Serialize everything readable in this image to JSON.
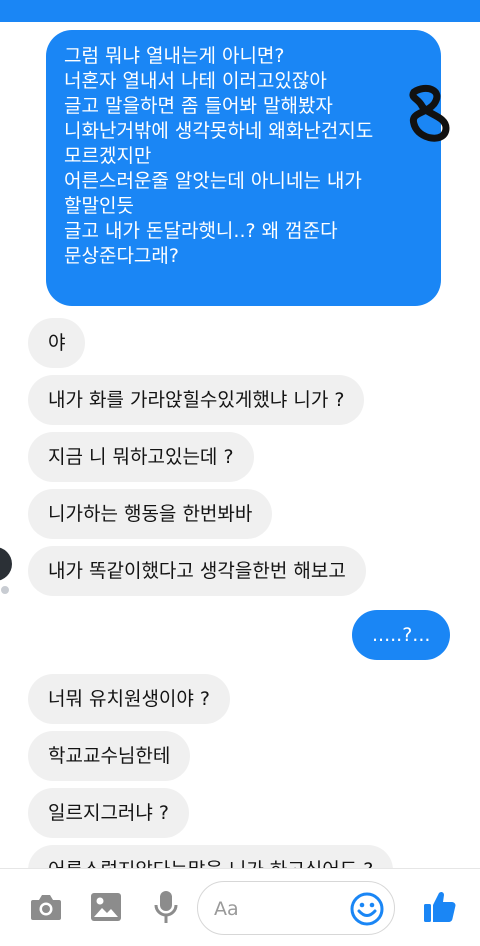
{
  "messages": {
    "sent_block": [
      "그럼 뭐냐 열내는게 아니면?",
      "너혼자 열내서 나테 이러고있잖아",
      "글고 말을하면 좀 들어봐 말해봤자",
      "니화난거밖에 생각못하네 왜화난건지도",
      "모르겠지만",
      "어른스러운줄 알앗는데 아니네는 내가",
      "할말인듯",
      "글고 내가 돈달라햇니..? 왜 껌준다",
      "문상준다그래?"
    ],
    "received_1": [
      "야",
      "내가 화를 가라앉힐수있게했냐 니가 ?",
      "지금 니 뭐하고있는데 ?",
      "니가하는 행동을 한번봐바",
      "내가 똑같이했다고 생각을한번 해보고"
    ],
    "sent_2": ".....?...",
    "received_2": [
      "너뭐 유치원생이야 ?",
      "학교교수님한테",
      "일르지그러냐 ?",
      "어른스럽지않다는말을 니가 하고싶어도 ?"
    ]
  },
  "sticker_text": "8",
  "composer": {
    "placeholder": "Aa"
  },
  "colors": {
    "accent": "#1a86f5",
    "incoming_bg": "#f0f0f0",
    "icon_gray": "#8c8c8c"
  },
  "icons": [
    "camera-icon",
    "image-icon",
    "microphone-icon",
    "emoji-icon",
    "thumbs-up-icon"
  ]
}
